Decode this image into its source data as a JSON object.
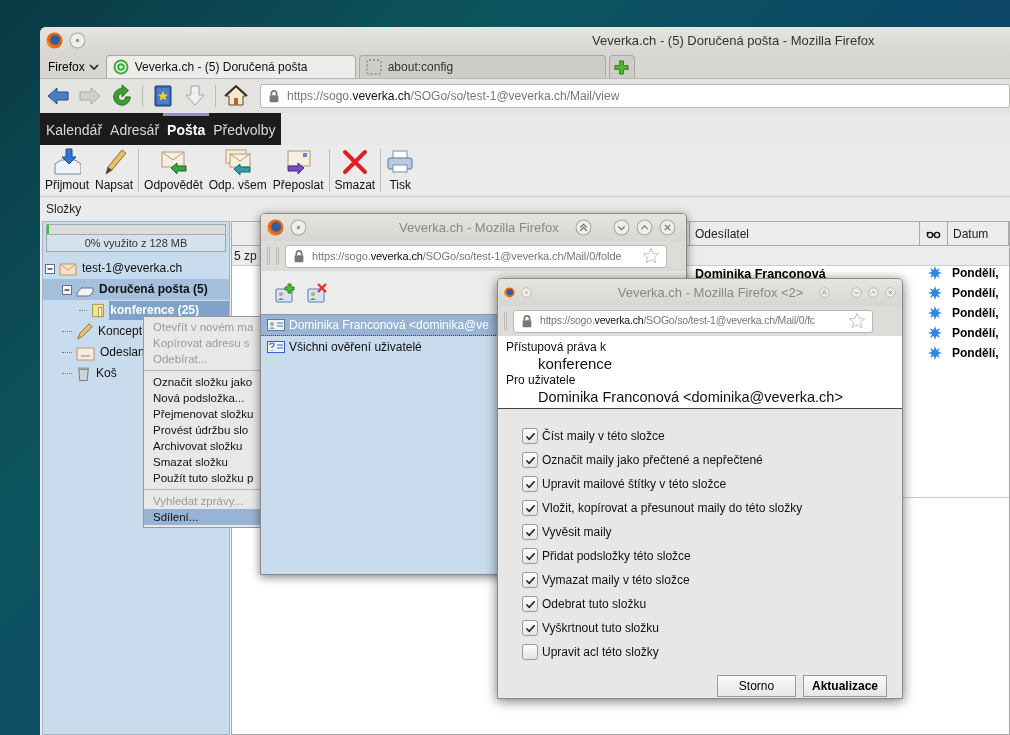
{
  "window": {
    "title": "Veverka.ch - (5) Doručená pošta - Mozilla Firefox"
  },
  "browser": {
    "menu_button": "Firefox",
    "tabs": [
      {
        "label": "Veverka.ch - (5) Doručená pošta",
        "selected": true
      },
      {
        "label": "about:config",
        "selected": false
      }
    ],
    "address": {
      "start": "https://sogo.",
      "domain": "veverka.ch",
      "path": "/SOGo/so/test-1@veverka.ch/Mail/view"
    }
  },
  "app_nav": [
    {
      "label": "Kalendář",
      "selected": false
    },
    {
      "label": "Adresář",
      "selected": false
    },
    {
      "label": "Pošta",
      "selected": true
    },
    {
      "label": "Předvolby",
      "selected": false
    }
  ],
  "toolbar": [
    {
      "label": "Přijmout",
      "kind": "receive",
      "separator_after": false
    },
    {
      "label": "Napsat",
      "kind": "compose",
      "separator_after": true
    },
    {
      "label": "Odpovědět",
      "kind": "reply",
      "separator_after": false
    },
    {
      "label": "Odp. všem",
      "kind": "reply_all",
      "separator_after": false
    },
    {
      "label": "Přeposlat",
      "kind": "forward",
      "separator_after": true
    },
    {
      "label": "Smazat",
      "kind": "delete",
      "separator_after": true
    },
    {
      "label": "Tisk",
      "kind": "print",
      "separator_after": false
    }
  ],
  "folders": {
    "title": "Složky",
    "quota": {
      "text": "0% využito z 128 MB",
      "level": 0
    },
    "tree": [
      {
        "label": "test-1@veverka.ch",
        "kind": "account",
        "expanded": true,
        "unread": false,
        "current": false,
        "selected": false,
        "children": [
          {
            "label": "Doručená pošta (5)",
            "kind": "inbox",
            "expanded": true,
            "unread": true,
            "current": true,
            "selected": false,
            "children": [
              {
                "label": "konference (25)",
                "kind": "folder",
                "unread": true,
                "current": false,
                "selected": true
              }
            ]
          },
          {
            "label": "Koncept",
            "kind": "drafts",
            "unread": false,
            "current": false,
            "selected": false
          },
          {
            "label": "Odeslan",
            "kind": "sent",
            "unread": false,
            "current": false,
            "selected": false
          },
          {
            "label": "Koš",
            "kind": "trash",
            "unread": false,
            "current": false,
            "selected": false
          }
        ]
      }
    ]
  },
  "message_list": {
    "columns": [
      {
        "kind": "text",
        "label": "Odesílatel"
      },
      {
        "kind": "icon"
      },
      {
        "kind": "text",
        "label": "Datum"
      }
    ],
    "summary": "5 zp",
    "rows": [
      {
        "sender": "Dominika Franconová",
        "date": "Pondělí,",
        "unread": true
      },
      {
        "date": "Pondělí,",
        "unread": true
      },
      {
        "date": "Pondělí,",
        "unread": true
      },
      {
        "date": "Pondělí,",
        "unread": true
      },
      {
        "date": "Pondělí,",
        "unread": true
      }
    ]
  },
  "context_menu": [
    {
      "kind": "item",
      "label": "Otevřít v novém ma",
      "disabled": true,
      "selected": false
    },
    {
      "kind": "item",
      "label": "Kopírovat adresu s",
      "disabled": true,
      "selected": false
    },
    {
      "kind": "item",
      "label": "Odebírat...",
      "disabled": true,
      "selected": false
    },
    {
      "kind": "separator"
    },
    {
      "kind": "item",
      "label": "Označit složku jako",
      "disabled": false,
      "selected": false
    },
    {
      "kind": "item",
      "label": "Nová podsložka...",
      "disabled": false,
      "selected": false
    },
    {
      "kind": "item",
      "label": "Přejmenovat složku",
      "disabled": false,
      "selected": false
    },
    {
      "kind": "item",
      "label": "Provést údržbu slo",
      "disabled": false,
      "selected": false
    },
    {
      "kind": "item",
      "label": "Archivovat složku",
      "disabled": false,
      "selected": false
    },
    {
      "kind": "item",
      "label": "Smazat složku",
      "disabled": false,
      "selected": false
    },
    {
      "kind": "item",
      "label": "Použít tuto složku p",
      "disabled": false,
      "selected": false
    },
    {
      "kind": "separator"
    },
    {
      "kind": "item",
      "label": "Vyhledat zprávy...",
      "disabled": true,
      "selected": false
    },
    {
      "kind": "item",
      "label": "Sdílení...",
      "disabled": false,
      "selected": true
    }
  ],
  "acl_window": {
    "title": "Veverka.ch - Mozilla Firefox",
    "address": {
      "start": "https://sogo.",
      "domain": "veverka.ch",
      "path": "/SOGo/so/test-1@veverka.ch/Mail/0/folde"
    },
    "users": [
      {
        "kind": "user",
        "label": "Dominika Franconová <dominika@ve",
        "selected": true
      },
      {
        "kind": "anyone",
        "label": "Všichni ověření uživatelé",
        "selected": false
      }
    ]
  },
  "rights_window": {
    "title": "Veverka.ch - Mozilla Firefox <2>",
    "address": {
      "start": "https://sogo.",
      "domain": "veverka.ch",
      "path": "/SOGo/so/test-1@veverka.ch/Mail/0/fc"
    },
    "rights_label": "Přístupová práva k",
    "folder": "konference",
    "user_label": "Pro uživatele",
    "user": "Dominika Franconová <dominika@veverka.ch>",
    "rights": [
      {
        "label": "Číst maily v této složce",
        "checked": true
      },
      {
        "label": "Označit maily jako přečtené a nepřečtené",
        "checked": true
      },
      {
        "label": "Upravit mailové štítky v této složce",
        "checked": true
      },
      {
        "label": "Vložit, kopírovat a přesunout maily do této složky",
        "checked": true
      },
      {
        "label": "Vyvěsit maily",
        "checked": true
      },
      {
        "label": "Přidat podsložky této složce",
        "checked": true
      },
      {
        "label": "Vymazat maily v této složce",
        "checked": true
      },
      {
        "label": "Odebrat tuto složku",
        "checked": true
      },
      {
        "label": "Vyškrtnout tuto složku",
        "checked": true
      },
      {
        "label": "Upravit acl této složky",
        "checked": false
      }
    ],
    "buttons": [
      {
        "label": "Storno",
        "default": false
      },
      {
        "label": "Aktualizace",
        "default": true
      }
    ]
  }
}
